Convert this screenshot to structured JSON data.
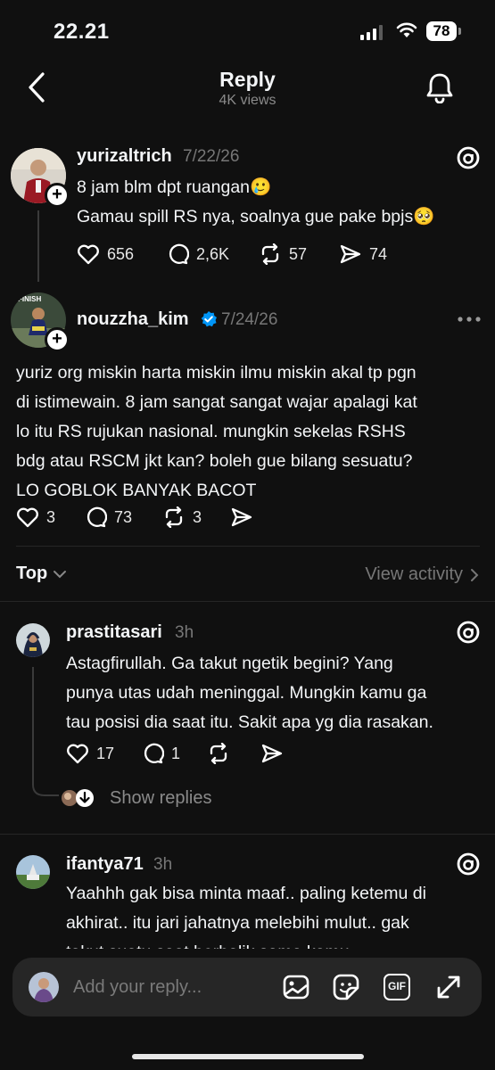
{
  "status_bar": {
    "time": "22.21",
    "battery": "78"
  },
  "header": {
    "title": "Reply",
    "subtitle": "4K views"
  },
  "posts": [
    {
      "username": "yurizaltrich",
      "date": "7/22/26",
      "lines": [
        "8 jam blm dpt ruangan🥲",
        "Gamau spill RS nya, soalnya gue pake bpjs🥺"
      ],
      "likes": "656",
      "comments": "2,6K",
      "reposts": "57",
      "shares": "74"
    },
    {
      "username": "nouzzha_kim",
      "date": "7/24/26",
      "avatar_text": "FINISH",
      "verified": true,
      "lines": [
        "yuriz org miskin harta miskin ilmu miskin akal tp pgn",
        "di istimewain. 8 jam sangat sangat wajar apalagi kat",
        "lo itu RS rujukan nasional. mungkin sekelas RSHS",
        "bdg atau RSCM jkt kan? boleh gue bilang sesuatu?",
        "LO GOBLOK BANYAK BACOT"
      ],
      "likes": "3",
      "comments": "73",
      "reposts": "3"
    }
  ],
  "sort": {
    "label": "Top",
    "view_activity": "View activity"
  },
  "replies": [
    {
      "username": "prastitasari",
      "time": "3h",
      "lines": [
        "Astagfirullah. Ga takut ngetik begini? Yang",
        "punya utas udah meninggal. Mungkin kamu ga",
        "tau posisi dia saat itu. Sakit apa yg dia rasakan."
      ],
      "likes": "17",
      "comments": "1",
      "show_replies": "Show replies"
    },
    {
      "username": "ifantya71",
      "time": "3h",
      "lines": [
        "Yaahhh gak bisa minta maaf.. paling ketemu di",
        "akhirat.. itu jari jahatnya melebihi mulut.. gak",
        "takut suatu saat berbalik sama kamu.."
      ]
    }
  ],
  "composer": {
    "placeholder": "Add your reply...",
    "gif_label": "GIF"
  },
  "colors": {
    "background": "#101010",
    "text": "#f3f5f7",
    "muted": "#777777",
    "verified": "#0095f6"
  }
}
